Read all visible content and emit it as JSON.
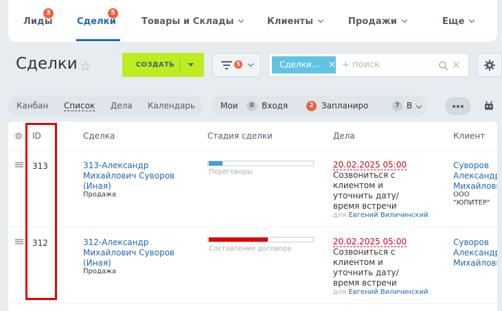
{
  "topnav": {
    "items": [
      {
        "label": "Лиды",
        "badge": "3"
      },
      {
        "label": "Сделки",
        "badge": "5",
        "active": true
      },
      {
        "label": "Товары и Склады"
      },
      {
        "label": "Клиенты"
      },
      {
        "label": "Продажи"
      },
      {
        "label": "Еще"
      }
    ]
  },
  "page": {
    "title": "Сделки"
  },
  "toolbar": {
    "create_label": "СОЗДАТЬ",
    "filter_count": "5",
    "search_chip": "Сделки...",
    "search_placeholder": "+ поиск"
  },
  "views": [
    {
      "label": "Канбан"
    },
    {
      "label": "Список",
      "active": true
    },
    {
      "label": "Дела"
    },
    {
      "label": "Календарь"
    }
  ],
  "counters": {
    "my_label": "Мои",
    "incoming_count": "0",
    "incoming_label": "Входя",
    "planned_count": "2",
    "planned_label": "Запланиро",
    "other_count": "7",
    "other_label": "В"
  },
  "colors": {
    "accent": "#2067b0",
    "create": "#bbed21",
    "badge": "#f0603d",
    "highlight": "#e30000"
  },
  "table": {
    "headers": {
      "id": "ID",
      "deal": "Сделка",
      "stage": "Стадия сделки",
      "activity": "Дела",
      "client": "Клиент"
    },
    "rows": [
      {
        "id": "313",
        "deal": "313-Александр Михайлович Суворов (Иная)",
        "type": "Продажа",
        "stage": "Переговоры",
        "stage_progress": 0.13,
        "stage_color": "#3d9de0",
        "act_date": "20.02.2025 05:00",
        "act_text": "Созвониться с клиентом и уточнить дату/время встречи",
        "act_for": "для",
        "act_person": "Евгений Виличинский",
        "client_l1": "Суворов",
        "client_l2": "Александр",
        "client_l3": "Михайлови",
        "company_l1": "ООО",
        "company_l2": "\"ЮПИТЕР\""
      },
      {
        "id": "312",
        "deal": "312-Александр Михайлович Суворов (Иная)",
        "type": "Продажа",
        "stage": "Составление договора",
        "stage_progress": 0.56,
        "stage_color": "#e30000",
        "act_date": "20.02.2025 05:00",
        "act_text": "Созвониться с клиентом и уточнить дату/время встречи",
        "act_for": "для",
        "act_person": "Евгений Виличинский",
        "client_l1": "Суворов",
        "client_l2": "Александр",
        "client_l3": "Михайлови"
      }
    ]
  }
}
